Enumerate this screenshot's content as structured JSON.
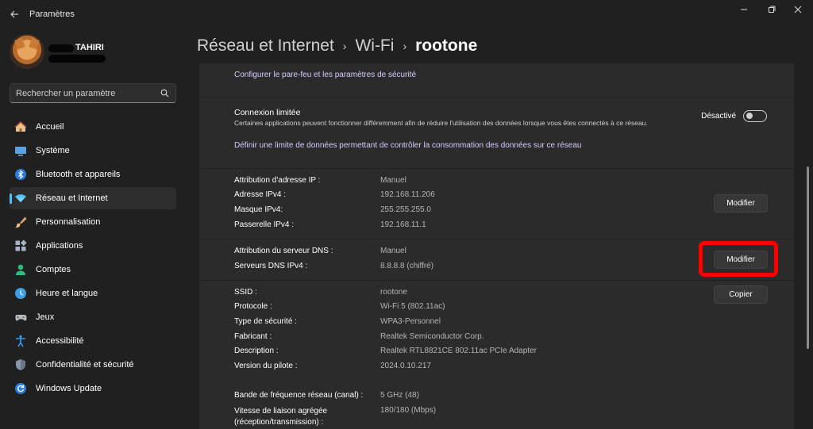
{
  "window": {
    "title": "Paramètres",
    "controls": [
      "minimize-icon",
      "maximize-icon",
      "close-icon"
    ]
  },
  "profile": {
    "name": "TAHIRI"
  },
  "search": {
    "placeholder": "Rechercher un paramètre"
  },
  "sidebar": {
    "items": [
      {
        "label": "Accueil",
        "icon": "home-icon",
        "selected": false
      },
      {
        "label": "Système",
        "icon": "system-icon",
        "selected": false
      },
      {
        "label": "Bluetooth et appareils",
        "icon": "bluetooth-icon",
        "selected": false
      },
      {
        "label": "Réseau et Internet",
        "icon": "wifi-icon",
        "selected": true
      },
      {
        "label": "Personnalisation",
        "icon": "brush-icon",
        "selected": false
      },
      {
        "label": "Applications",
        "icon": "apps-icon",
        "selected": false
      },
      {
        "label": "Comptes",
        "icon": "account-icon",
        "selected": false
      },
      {
        "label": "Heure et langue",
        "icon": "clock-icon",
        "selected": false
      },
      {
        "label": "Jeux",
        "icon": "gamepad-icon",
        "selected": false
      },
      {
        "label": "Accessibilité",
        "icon": "accessibility-icon",
        "selected": false
      },
      {
        "label": "Confidentialité et sécurité",
        "icon": "shield-icon",
        "selected": false
      },
      {
        "label": "Windows Update",
        "icon": "update-icon",
        "selected": false
      }
    ]
  },
  "breadcrumb": {
    "items": [
      "Réseau et Internet",
      "Wi-Fi"
    ],
    "current": "rootone"
  },
  "firewall_link": "Configurer le pare-feu et les paramètres de sécurité",
  "metered": {
    "title": "Connexion limitée",
    "description": "Certaines applications peuvent fonctionner différemment afin de réduire l'utilisation des données lorsque vous êtes connectés à ce réseau.",
    "toggle_label": "Désactivé",
    "toggle_on": false,
    "limit_link": "Définir une limite de données permettant de contrôler la consommation des données sur ce réseau"
  },
  "ip_section": {
    "rows": [
      {
        "label": "Attribution d'adresse IP :",
        "value": "Manuel"
      },
      {
        "label": "Adresse IPv4 :",
        "value": "192.168.11.206"
      },
      {
        "label": "Masque IPv4:",
        "value": "255.255.255.0"
      },
      {
        "label": "Passerelle IPv4 :",
        "value": "192.168.11.1"
      }
    ],
    "button": "Modifier"
  },
  "dns_section": {
    "rows": [
      {
        "label": "Attribution du serveur DNS :",
        "value": "Manuel"
      },
      {
        "label": "Serveurs DNS IPv4 :",
        "value": "8.8.8.8 (chiffré)"
      }
    ],
    "button": "Modifier",
    "highlight_color": "#ff0000"
  },
  "props_section": {
    "rows": [
      {
        "label": "SSID :",
        "value": "rootone"
      },
      {
        "label": "Protocole :",
        "value": "Wi-Fi 5 (802.11ac)"
      },
      {
        "label": "Type de sécurité :",
        "value": "WPA3-Personnel"
      },
      {
        "label": "Fabricant :",
        "value": "Realtek Semiconductor Corp."
      },
      {
        "label": "Description :",
        "value": "Realtek RTL8821CE 802.11ac PCIe Adapter"
      },
      {
        "label": "Version du pilote :",
        "value": "2024.0.10.217"
      },
      {
        "label": "Bande de fréquence réseau (canal) :",
        "value": "5 GHz (48)"
      },
      {
        "label": "Vitesse de liaison agrégée",
        "label2": "(réception/transmission) :",
        "value": "180/180 (Mbps)"
      }
    ],
    "button": "Copier"
  },
  "colors": {
    "background": "#202020",
    "card": "#2b2b2b",
    "accent": "#4cc2ff",
    "link": "#dcc8ff"
  }
}
